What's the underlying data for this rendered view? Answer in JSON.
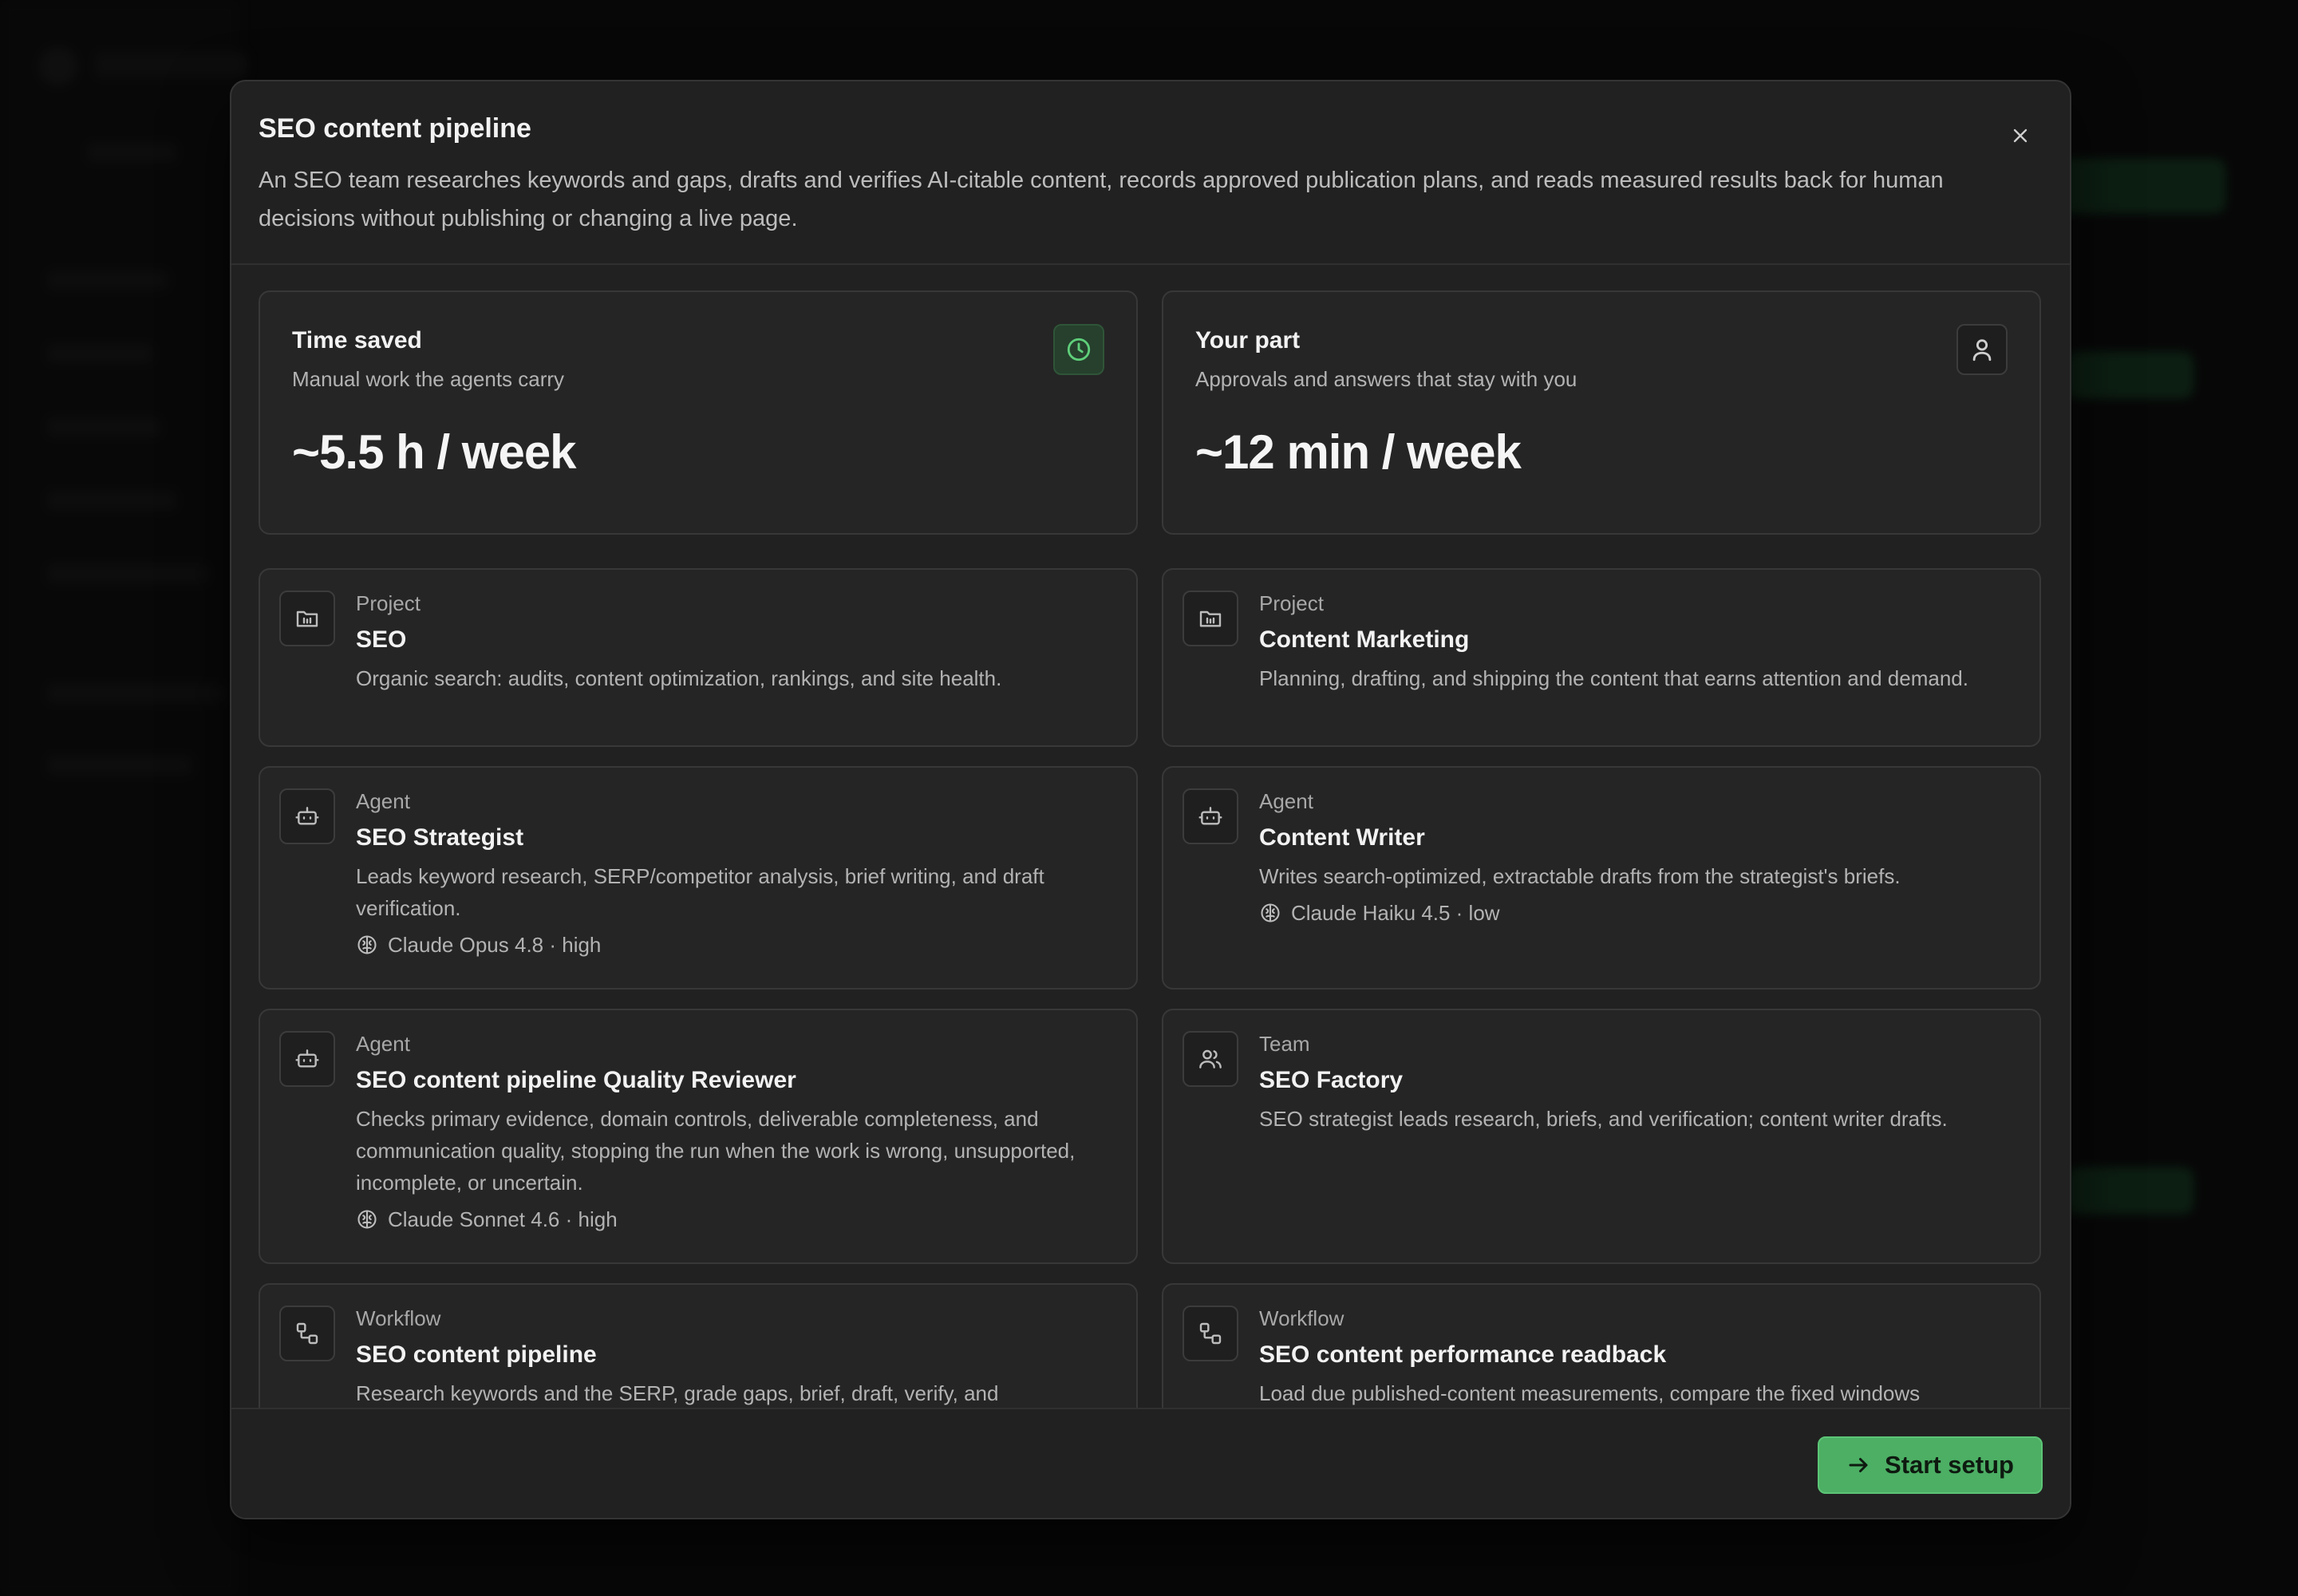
{
  "modal": {
    "title": "SEO content pipeline",
    "description": "An SEO team researches keywords and gaps, drafts and verifies AI-citable content, records approved publication plans, and reads measured results back for human decisions without publishing or changing a live page.",
    "close_icon": "close-icon"
  },
  "stats": [
    {
      "title": "Time saved",
      "subtitle": "Manual work the agents carry",
      "value": "~5.5 h / week",
      "icon": "clock-icon",
      "accent": "#4caf64"
    },
    {
      "title": "Your part",
      "subtitle": "Approvals and answers that stay with you",
      "value": "~12 min / week",
      "icon": "user-icon"
    }
  ],
  "items": [
    {
      "kind": "Project",
      "name": "SEO",
      "description": "Organic search: audits, content optimization, rankings, and site health.",
      "icon": "folder-icon"
    },
    {
      "kind": "Project",
      "name": "Content Marketing",
      "description": "Planning, drafting, and shipping the content that earns attention and demand.",
      "icon": "folder-icon"
    },
    {
      "kind": "Agent",
      "name": "SEO Strategist",
      "description": "Leads keyword research, SERP/competitor analysis, brief writing, and draft verification.",
      "model": "Claude Opus 4.8 · high",
      "icon": "bot-icon"
    },
    {
      "kind": "Agent",
      "name": "Content Writer",
      "description": "Writes search-optimized, extractable drafts from the strategist's briefs.",
      "model": "Claude Haiku 4.5 · low",
      "icon": "bot-icon"
    },
    {
      "kind": "Agent",
      "name": "SEO content pipeline Quality Reviewer",
      "description": "Checks primary evidence, domain controls, deliverable completeness, and communication quality, stopping the run when the work is wrong, unsupported, incomplete, or uncertain.",
      "model": "Claude Sonnet 4.6 · high",
      "icon": "bot-icon"
    },
    {
      "kind": "Team",
      "name": "SEO Factory",
      "description": "SEO strategist leads research, briefs, and verification; content writer drafts.",
      "icon": "users-icon"
    },
    {
      "kind": "Workflow",
      "name": "SEO content pipeline",
      "description": "Research keywords and the SERP, grade gaps, brief, draft, verify, and",
      "icon": "workflow-icon"
    },
    {
      "kind": "Workflow",
      "name": "SEO content performance readback",
      "description": "Load due published-content measurements, compare the fixed windows",
      "icon": "workflow-icon"
    }
  ],
  "footer": {
    "start_label": "Start setup",
    "start_icon": "arrow-right-icon",
    "accent": "#4caf64"
  }
}
